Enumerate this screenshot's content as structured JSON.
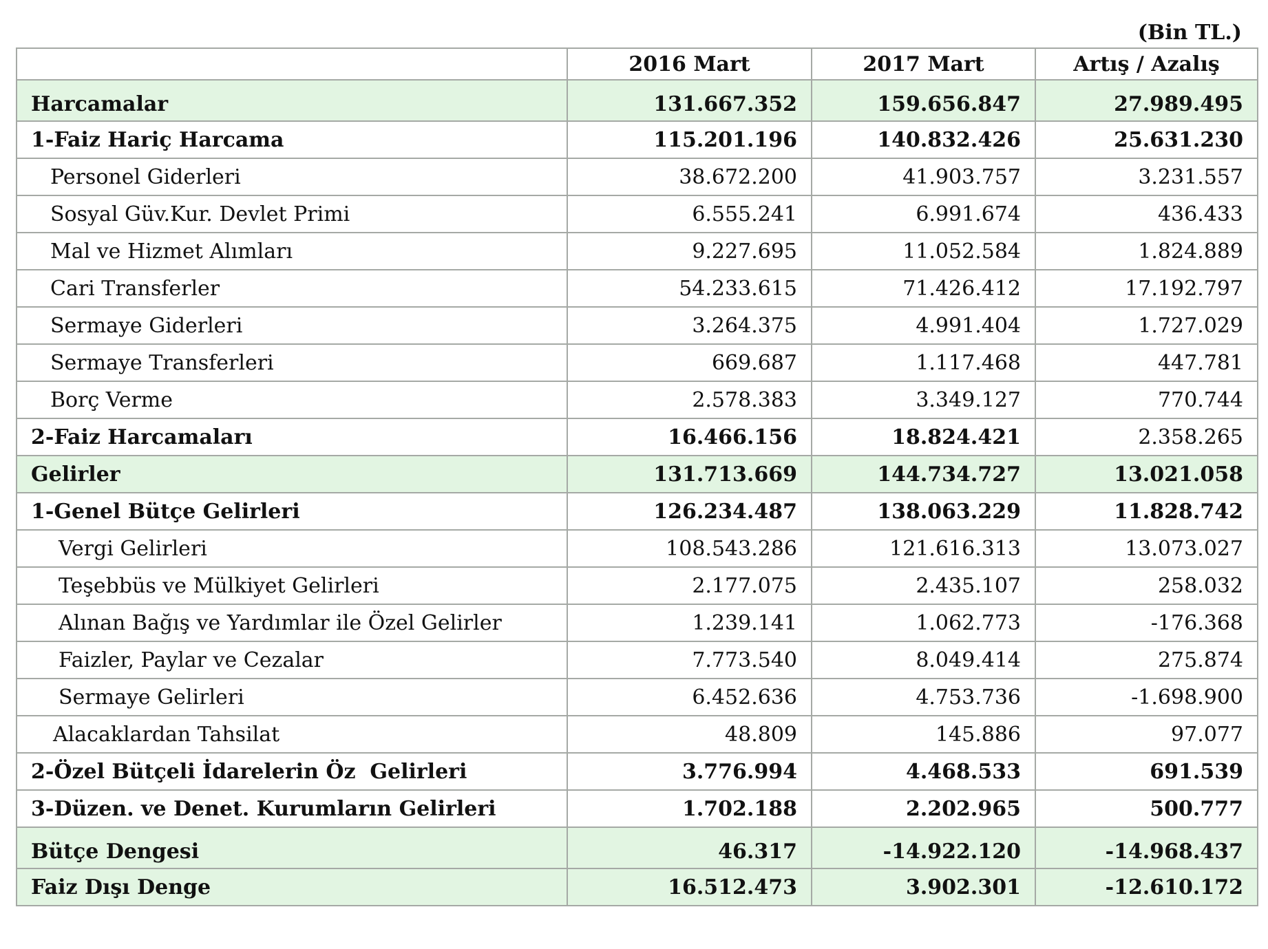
{
  "unit_label": "(Bin TL.)",
  "header": {
    "col1": "",
    "col2": "2016 Mart",
    "col3": "2017 Mart",
    "col4": "Artış / Azalış"
  },
  "rows": [
    {
      "label": "Harcamalar",
      "v2016": "131.667.352",
      "v2017": "159.656.847",
      "change": "27.989.495"
    },
    {
      "label": "1-Faiz Hariç Harcama",
      "v2016": "115.201.196",
      "v2017": "140.832.426",
      "change": "25.631.230"
    },
    {
      "label": "Personel Giderleri",
      "v2016": "38.672.200",
      "v2017": "41.903.757",
      "change": "3.231.557"
    },
    {
      "label": "Sosyal Güv.Kur. Devlet Primi",
      "v2016": "6.555.241",
      "v2017": "6.991.674",
      "change": "436.433"
    },
    {
      "label": "Mal ve Hizmet Alımları",
      "v2016": "9.227.695",
      "v2017": "11.052.584",
      "change": "1.824.889"
    },
    {
      "label": "Cari Transferler",
      "v2016": "54.233.615",
      "v2017": "71.426.412",
      "change": "17.192.797"
    },
    {
      "label": "Sermaye Giderleri",
      "v2016": "3.264.375",
      "v2017": "4.991.404",
      "change": "1.727.029"
    },
    {
      "label": "Sermaye Transferleri",
      "v2016": "669.687",
      "v2017": "1.117.468",
      "change": "447.781"
    },
    {
      "label": "Borç Verme",
      "v2016": "2.578.383",
      "v2017": "3.349.127",
      "change": "770.744"
    },
    {
      "label": "2-Faiz Harcamaları",
      "v2016": "16.466.156",
      "v2017": "18.824.421",
      "change": "2.358.265"
    },
    {
      "label": "Gelirler",
      "v2016": "131.713.669",
      "v2017": "144.734.727",
      "change": "13.021.058"
    },
    {
      "label": "1-Genel Bütçe Gelirleri",
      "v2016": "126.234.487",
      "v2017": "138.063.229",
      "change": "11.828.742"
    },
    {
      "label": "Vergi Gelirleri",
      "v2016": "108.543.286",
      "v2017": "121.616.313",
      "change": "13.073.027"
    },
    {
      "label": "Teşebbüs ve Mülkiyet Gelirleri",
      "v2016": "2.177.075",
      "v2017": "2.435.107",
      "change": "258.032"
    },
    {
      "label": "Alınan Bağış ve Yardımlar ile Özel Gelirler",
      "v2016": "1.239.141",
      "v2017": "1.062.773",
      "change": "-176.368"
    },
    {
      "label": "Faizler, Paylar ve Cezalar",
      "v2016": "7.773.540",
      "v2017": "8.049.414",
      "change": "275.874"
    },
    {
      "label": "Sermaye Gelirleri",
      "v2016": "6.452.636",
      "v2017": "4.753.736",
      "change": "-1.698.900"
    },
    {
      "label": "Alacaklardan Tahsilat",
      "v2016": "48.809",
      "v2017": "145.886",
      "change": "97.077"
    },
    {
      "label": "2-Özel Bütçeli İdarelerin Öz  Gelirleri",
      "v2016": "3.776.994",
      "v2017": "4.468.533",
      "change": "691.539"
    },
    {
      "label": "3-Düzen. ve Denet. Kurumların Gelirleri",
      "v2016": "1.702.188",
      "v2017": "2.202.965",
      "change": "500.777"
    },
    {
      "label": "Bütçe Dengesi",
      "v2016": "46.317",
      "v2017": "-14.922.120",
      "change": "-14.968.437"
    },
    {
      "label": "Faiz Dışı Denge",
      "v2016": "16.512.473",
      "v2017": "3.902.301",
      "change": "-12.610.172"
    }
  ]
}
